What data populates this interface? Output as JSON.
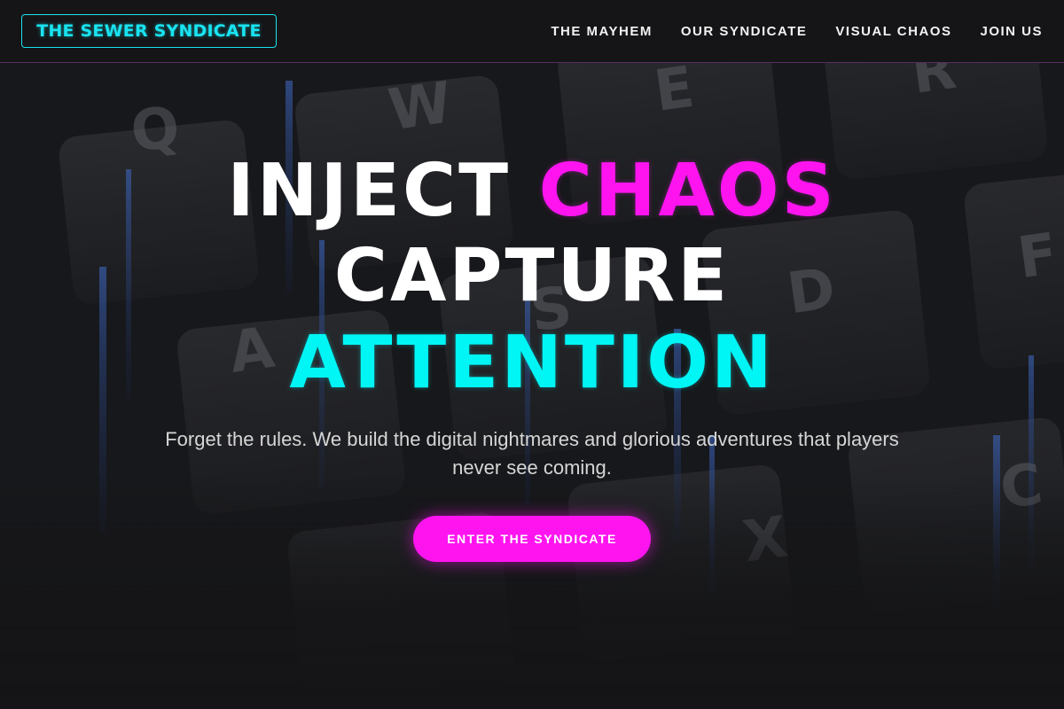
{
  "brand": {
    "logo_text": "THE SEWER SYNDICATE"
  },
  "nav": {
    "items": [
      {
        "label": "THE MAYHEM"
      },
      {
        "label": "OUR SYNDICATE"
      },
      {
        "label": "VISUAL CHAOS"
      },
      {
        "label": "JOIN US"
      }
    ]
  },
  "hero": {
    "line1_a": "INJECT",
    "line1_b": "CHAOS",
    "line2": "CAPTURE",
    "line3": "ATTENTION",
    "tagline": "Forget the rules. We build the digital nightmares and glorious adventures that players never see coming.",
    "cta_label": "ENTER THE SYNDICATE"
  },
  "background": {
    "key_letters": [
      "Q",
      "W",
      "E",
      "R",
      "A",
      "S",
      "D",
      "F",
      "X",
      "C"
    ]
  },
  "colors": {
    "background": "#151517",
    "accent_cyan": "#00f5f5",
    "accent_magenta": "#ff14f0",
    "nav_border": "#5a2a63"
  }
}
